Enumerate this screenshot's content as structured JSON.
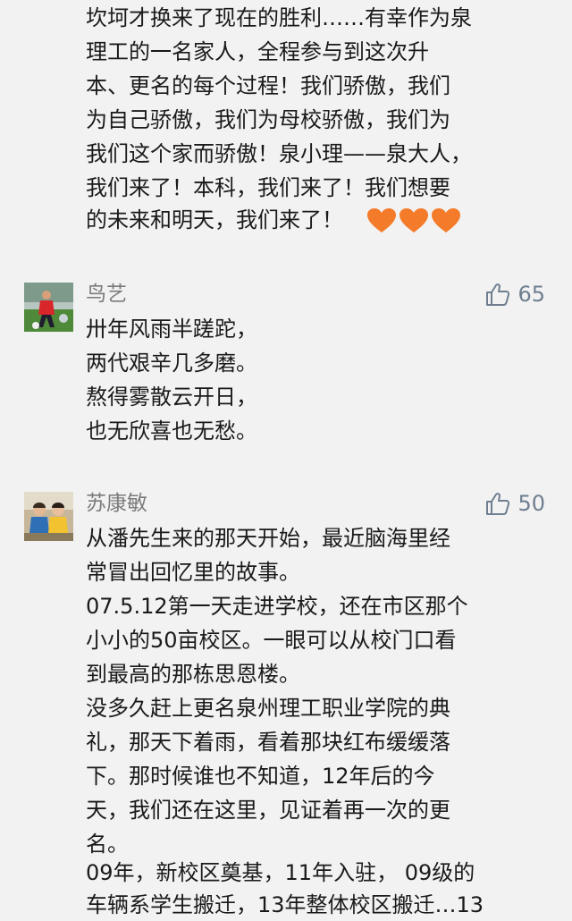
{
  "first_comment": {
    "lines": [
      "坎坷才换来了现在的胜利……有幸作为泉",
      "理工的一名家人，全程参与到这次升",
      "本、更名的每个过程！我们骄傲，我们",
      "为自己骄傲，我们为母校骄傲，我们为",
      "我们这个家而骄傲！泉小理——泉大人，",
      "我们来了！本科，我们来了！我们想要",
      "的未来和明天，我们来了！"
    ],
    "emoji": "orange-heart-icon x3"
  },
  "comments": [
    {
      "username": "鸟艺",
      "likes": "65",
      "lines": [
        "卅年风雨半蹉跎，",
        "两代艰辛几多磨。",
        "熬得雾散云开日，",
        "也无欣喜也无愁。"
      ]
    },
    {
      "username": "苏康敏",
      "likes": "50",
      "lines": [
        "从潘先生来的那天开始，最近脑海里经",
        "常冒出回忆里的故事。",
        "07.5.12第一天走进学校，还在市区那个",
        "小小的50亩校区。一眼可以从校门口看",
        "到最高的那栋思恩楼。",
        "没多久赶上更名泉州理工职业学院的典",
        "礼，那天下着雨，看着那块红布缓缓落",
        "下。那时候谁也不知道，12年后的今",
        "天，我们还在这里，见证着再一次的更",
        "名。",
        "09年，新校区奠基，11年入驻， 09级的",
        "车辆系学生搬迁，13年整体校区搬迁…13"
      ]
    }
  ],
  "colors": {
    "background": "#f2f2f2",
    "username": "#7b7b7b",
    "like": "#6f7f90",
    "heart": "#f47b2a"
  }
}
